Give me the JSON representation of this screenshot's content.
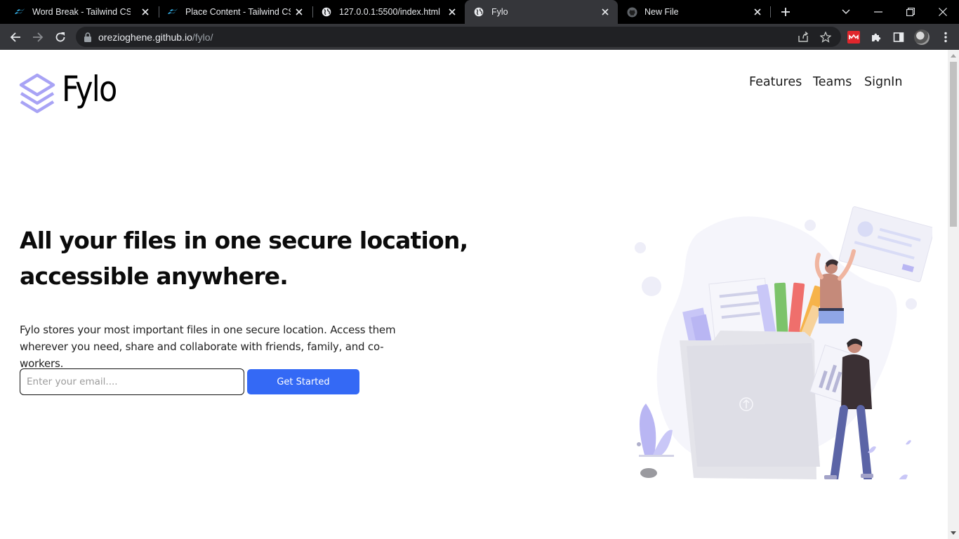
{
  "browser": {
    "tabs": [
      {
        "title": "Word Break - Tailwind CSS",
        "icon": "tailwind-icon",
        "active": false
      },
      {
        "title": "Place Content - Tailwind CSS",
        "icon": "tailwind-icon",
        "active": false
      },
      {
        "title": "127.0.0.1:5500/index.html",
        "icon": "globe-icon",
        "active": false
      },
      {
        "title": "Fylo",
        "icon": "globe-icon",
        "active": true
      },
      {
        "title": "New File",
        "icon": "github-icon",
        "active": false
      }
    ],
    "address": {
      "host": "orezioghene.github.io",
      "path": "/fylo/"
    }
  },
  "site": {
    "brand": "Fylo",
    "nav": [
      "Features",
      "Teams",
      "SignIn"
    ],
    "hero": {
      "title_line1": "All your files in one secure location,",
      "title_line2": "accessible anywhere.",
      "description_line1": "Fylo stores your most important files in one secure location. Access them",
      "description_line2": "wherever you need, share and collaborate with friends, family, and co-workers."
    },
    "form": {
      "email_placeholder": "Enter your email....",
      "email_value": "",
      "cta_label": "Get Started"
    }
  },
  "colors": {
    "accent": "#3469f5",
    "logo": "#a8a3f5",
    "chrome_dark": "#35363a"
  }
}
